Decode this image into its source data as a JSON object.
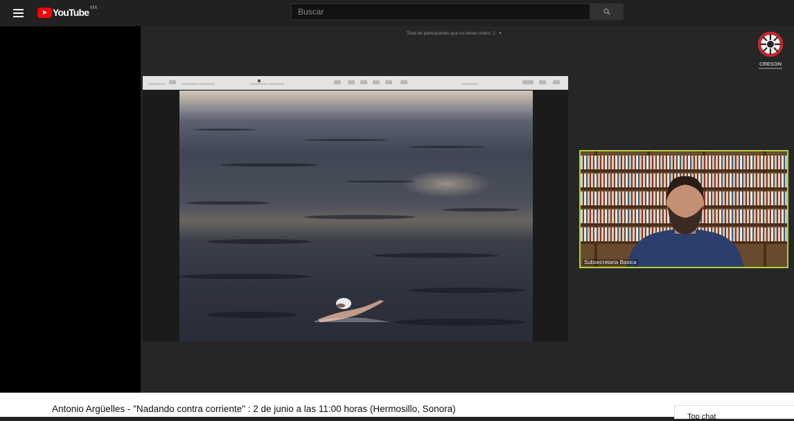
{
  "masthead": {
    "logo_text": "YouTube",
    "country_code": "MX",
    "search_placeholder": "Buscar",
    "icons": {
      "menu": "hamburger-menu-icon",
      "logo": "youtube-logo-icon",
      "search": "search-icon"
    },
    "colors": {
      "brand": "#ff0000",
      "background": "#212121"
    }
  },
  "video": {
    "participants_text": "Total de participantes que no tienen vídeo: 2",
    "participants_arrow": "▾",
    "org_logo_text": "CRESON",
    "speaker_name": "Subsecretaria Basica",
    "speaker_border_color": "#a8d33a"
  },
  "below": {
    "title": "Antonio Argüelles - \"Nadando contra corriente\" : 2 de junio a las 11:00 horas (Hermosillo, Sonora)",
    "chat_label": "Top chat"
  }
}
